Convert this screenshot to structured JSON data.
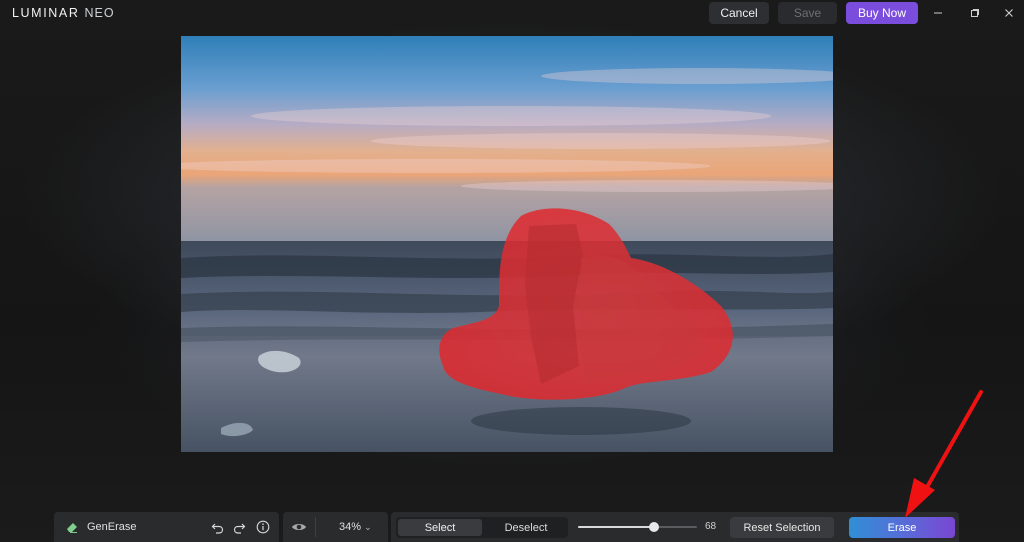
{
  "app": {
    "logo_main": "LUMINAR ",
    "logo_neo": "NEO"
  },
  "header": {
    "cancel_label": "Cancel",
    "save_label": "Save",
    "buy_label": "Buy Now",
    "minimize_icon": "minimize-icon",
    "maximize_icon": "restore-icon",
    "close_icon": "close-icon"
  },
  "tool": {
    "name": "GenErase",
    "icon": "eraser-icon",
    "zoom": "34%",
    "zoom_caret": "⌄",
    "select_label": "Select",
    "deselect_label": "Deselect",
    "brush_size": "68",
    "brush_size_fraction": 0.64,
    "reset_label": "Reset Selection",
    "erase_label": "Erase"
  },
  "colors": {
    "accent_purple": "#7b4ddd",
    "mask_red": "#e0282d",
    "annotation_arrow": "#f01212"
  }
}
